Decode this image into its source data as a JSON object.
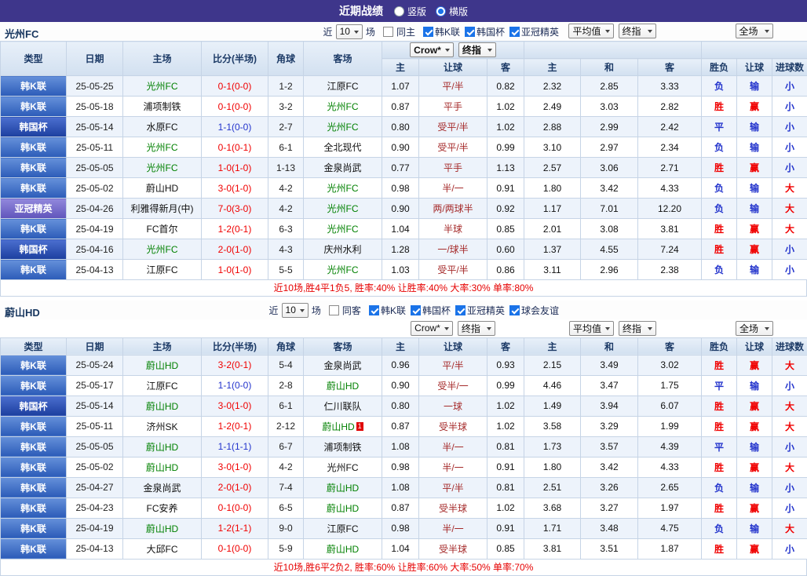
{
  "topbar": {
    "title": "近期战绩",
    "view_options": [
      {
        "label": "竖版",
        "selected": false
      },
      {
        "label": "横版",
        "selected": true
      }
    ]
  },
  "colors": {
    "topbar_purple": "#3e368b",
    "win_red": "#f00000",
    "lose_blue": "#2233cc",
    "self_team_green": "#008000",
    "handicap_text": "#a52a2a",
    "header_blue": "#d2e0f0"
  },
  "dropdowns": {
    "bookmaker": "Crow*",
    "final1": "终指",
    "average": "平均值",
    "final2": "终指",
    "scope": "全场"
  },
  "table_headers": {
    "type": "类型",
    "date": "日期",
    "home": "主场",
    "score": "比分(半场)",
    "corner": "角球",
    "away": "客场",
    "odds_home": "主",
    "odds_line": "让球",
    "odds_away": "客",
    "avg_home": "主",
    "avg_draw": "和",
    "avg_away": "客",
    "result": "胜负",
    "handicap_result": "让球",
    "goals_result": "进球数"
  },
  "sections": [
    {
      "team": "光州FC",
      "filters": {
        "prefix": "近",
        "count": "10",
        "suffix": "场",
        "venue": {
          "label": "同主",
          "checked": false
        },
        "competitions": [
          {
            "label": "韩K联",
            "checked": true
          },
          {
            "label": "韩国杯",
            "checked": true
          },
          {
            "label": "亚冠精英",
            "checked": true
          }
        ]
      },
      "rows": [
        {
          "type": "韩K联",
          "ts": "k",
          "date": "25-05-25",
          "home": "光州FC",
          "home_self": true,
          "score": "0-1(0-0)",
          "score_c": "red",
          "corner": "1-2",
          "away": "江原FC",
          "away_self": false,
          "o1": "1.07",
          "line": "平/半",
          "o2": "0.82",
          "a1": "2.32",
          "a2": "2.85",
          "a3": "3.33",
          "r1": "负",
          "r1c": "blue",
          "r2": "输",
          "r2c": "blue",
          "r3": "小",
          "r3c": "blue"
        },
        {
          "type": "韩K联",
          "ts": "k",
          "date": "25-05-18",
          "home": "浦项制铁",
          "home_self": false,
          "score": "0-1(0-0)",
          "score_c": "red",
          "corner": "3-2",
          "away": "光州FC",
          "away_self": true,
          "o1": "0.87",
          "line": "平手",
          "o2": "1.02",
          "a1": "2.49",
          "a2": "3.03",
          "a3": "2.82",
          "r1": "胜",
          "r1c": "red",
          "r2": "赢",
          "r2c": "red",
          "r3": "小",
          "r3c": "blue"
        },
        {
          "type": "韩国杯",
          "ts": "cup",
          "date": "25-05-14",
          "home": "水原FC",
          "home_self": false,
          "score": "1-1(0-0)",
          "score_c": "blue",
          "corner": "2-7",
          "away": "光州FC",
          "away_self": true,
          "o1": "0.80",
          "line": "受平/半",
          "o2": "1.02",
          "a1": "2.88",
          "a2": "2.99",
          "a3": "2.42",
          "r1": "平",
          "r1c": "blue",
          "r2": "输",
          "r2c": "blue",
          "r3": "小",
          "r3c": "blue"
        },
        {
          "type": "韩K联",
          "ts": "k",
          "date": "25-05-11",
          "home": "光州FC",
          "home_self": true,
          "score": "0-1(0-1)",
          "score_c": "red",
          "corner": "6-1",
          "away": "全北现代",
          "away_self": false,
          "o1": "0.90",
          "line": "受平/半",
          "o2": "0.99",
          "a1": "3.10",
          "a2": "2.97",
          "a3": "2.34",
          "r1": "负",
          "r1c": "blue",
          "r2": "输",
          "r2c": "blue",
          "r3": "小",
          "r3c": "blue"
        },
        {
          "type": "韩K联",
          "ts": "k",
          "date": "25-05-05",
          "home": "光州FC",
          "home_self": true,
          "score": "1-0(1-0)",
          "score_c": "red",
          "corner": "1-13",
          "away": "金泉尚武",
          "away_self": false,
          "o1": "0.77",
          "line": "平手",
          "o2": "1.13",
          "a1": "2.57",
          "a2": "3.06",
          "a3": "2.71",
          "r1": "胜",
          "r1c": "red",
          "r2": "赢",
          "r2c": "red",
          "r3": "小",
          "r3c": "blue"
        },
        {
          "type": "韩K联",
          "ts": "k",
          "date": "25-05-02",
          "home": "蔚山HD",
          "home_self": false,
          "score": "3-0(1-0)",
          "score_c": "red",
          "corner": "4-2",
          "away": "光州FC",
          "away_self": true,
          "o1": "0.98",
          "line": "半/一",
          "o2": "0.91",
          "a1": "1.80",
          "a2": "3.42",
          "a3": "4.33",
          "r1": "负",
          "r1c": "blue",
          "r2": "输",
          "r2c": "blue",
          "r3": "大",
          "r3c": "red"
        },
        {
          "type": "亚冠精英",
          "ts": "acl",
          "date": "25-04-26",
          "home": "利雅得新月(中)",
          "home_self": false,
          "score": "7-0(3-0)",
          "score_c": "red",
          "corner": "4-2",
          "away": "光州FC",
          "away_self": true,
          "o1": "0.90",
          "line": "两/两球半",
          "o2": "0.92",
          "a1": "1.17",
          "a2": "7.01",
          "a3": "12.20",
          "r1": "负",
          "r1c": "blue",
          "r2": "输",
          "r2c": "blue",
          "r3": "大",
          "r3c": "red"
        },
        {
          "type": "韩K联",
          "ts": "k",
          "date": "25-04-19",
          "home": "FC首尔",
          "home_self": false,
          "score": "1-2(0-1)",
          "score_c": "red",
          "corner": "6-3",
          "away": "光州FC",
          "away_self": true,
          "o1": "1.04",
          "line": "半球",
          "o2": "0.85",
          "a1": "2.01",
          "a2": "3.08",
          "a3": "3.81",
          "r1": "胜",
          "r1c": "red",
          "r2": "赢",
          "r2c": "red",
          "r3": "大",
          "r3c": "red"
        },
        {
          "type": "韩国杯",
          "ts": "cup",
          "date": "25-04-16",
          "home": "光州FC",
          "home_self": true,
          "score": "2-0(1-0)",
          "score_c": "red",
          "corner": "4-3",
          "away": "庆州水利",
          "away_self": false,
          "o1": "1.28",
          "line": "一/球半",
          "o2": "0.60",
          "a1": "1.37",
          "a2": "4.55",
          "a3": "7.24",
          "r1": "胜",
          "r1c": "red",
          "r2": "赢",
          "r2c": "red",
          "r3": "小",
          "r3c": "blue"
        },
        {
          "type": "韩K联",
          "ts": "k",
          "date": "25-04-13",
          "home": "江原FC",
          "home_self": false,
          "score": "1-0(1-0)",
          "score_c": "red",
          "corner": "5-5",
          "away": "光州FC",
          "away_self": true,
          "o1": "1.03",
          "line": "受平/半",
          "o2": "0.86",
          "a1": "3.11",
          "a2": "2.96",
          "a3": "2.38",
          "r1": "负",
          "r1c": "blue",
          "r2": "输",
          "r2c": "blue",
          "r3": "小",
          "r3c": "blue"
        }
      ],
      "summary": "近10场,胜4平1负5, 胜率:40% 让胜率:40% 大率:30% 单率:80%"
    },
    {
      "team": "蔚山HD",
      "filters": {
        "prefix": "近",
        "count": "10",
        "suffix": "场",
        "venue": {
          "label": "同客",
          "checked": false
        },
        "competitions": [
          {
            "label": "韩K联",
            "checked": true
          },
          {
            "label": "韩国杯",
            "checked": true
          },
          {
            "label": "亚冠精英",
            "checked": true
          },
          {
            "label": "球会友谊",
            "checked": true
          }
        ]
      },
      "rows": [
        {
          "type": "韩K联",
          "ts": "k",
          "date": "25-05-24",
          "home": "蔚山HD",
          "home_self": true,
          "score": "3-2(0-1)",
          "score_c": "red",
          "corner": "5-4",
          "away": "金泉尚武",
          "away_self": false,
          "o1": "0.96",
          "line": "平/半",
          "o2": "0.93",
          "a1": "2.15",
          "a2": "3.49",
          "a3": "3.02",
          "r1": "胜",
          "r1c": "red",
          "r2": "赢",
          "r2c": "red",
          "r3": "大",
          "r3c": "red"
        },
        {
          "type": "韩K联",
          "ts": "k",
          "date": "25-05-17",
          "home": "江原FC",
          "home_self": false,
          "score": "1-1(0-0)",
          "score_c": "blue",
          "corner": "2-8",
          "away": "蔚山HD",
          "away_self": true,
          "o1": "0.90",
          "line": "受半/一",
          "o2": "0.99",
          "a1": "4.46",
          "a2": "3.47",
          "a3": "1.75",
          "r1": "平",
          "r1c": "blue",
          "r2": "输",
          "r2c": "blue",
          "r3": "小",
          "r3c": "blue"
        },
        {
          "type": "韩国杯",
          "ts": "cup",
          "date": "25-05-14",
          "home": "蔚山HD",
          "home_self": true,
          "score": "3-0(1-0)",
          "score_c": "red",
          "corner": "6-1",
          "away": "仁川联队",
          "away_self": false,
          "o1": "0.80",
          "line": "一球",
          "o2": "1.02",
          "a1": "1.49",
          "a2": "3.94",
          "a3": "6.07",
          "r1": "胜",
          "r1c": "red",
          "r2": "赢",
          "r2c": "red",
          "r3": "大",
          "r3c": "red"
        },
        {
          "type": "韩K联",
          "ts": "k",
          "date": "25-05-11",
          "home": "济州SK",
          "home_self": false,
          "score": "1-2(0-1)",
          "score_c": "red",
          "corner": "2-12",
          "away": "蔚山HD",
          "away_self": true,
          "away_badge": "1",
          "o1": "0.87",
          "line": "受半球",
          "o2": "1.02",
          "a1": "3.58",
          "a2": "3.29",
          "a3": "1.99",
          "r1": "胜",
          "r1c": "red",
          "r2": "赢",
          "r2c": "red",
          "r3": "大",
          "r3c": "red"
        },
        {
          "type": "韩K联",
          "ts": "k",
          "date": "25-05-05",
          "home": "蔚山HD",
          "home_self": true,
          "score": "1-1(1-1)",
          "score_c": "blue",
          "corner": "6-7",
          "away": "浦项制铁",
          "away_self": false,
          "o1": "1.08",
          "line": "半/一",
          "o2": "0.81",
          "a1": "1.73",
          "a2": "3.57",
          "a3": "4.39",
          "r1": "平",
          "r1c": "blue",
          "r2": "输",
          "r2c": "blue",
          "r3": "小",
          "r3c": "blue"
        },
        {
          "type": "韩K联",
          "ts": "k",
          "date": "25-05-02",
          "home": "蔚山HD",
          "home_self": true,
          "score": "3-0(1-0)",
          "score_c": "red",
          "corner": "4-2",
          "away": "光州FC",
          "away_self": false,
          "o1": "0.98",
          "line": "半/一",
          "o2": "0.91",
          "a1": "1.80",
          "a2": "3.42",
          "a3": "4.33",
          "r1": "胜",
          "r1c": "red",
          "r2": "赢",
          "r2c": "red",
          "r3": "大",
          "r3c": "red"
        },
        {
          "type": "韩K联",
          "ts": "k",
          "date": "25-04-27",
          "home": "金泉尚武",
          "home_self": false,
          "score": "2-0(1-0)",
          "score_c": "red",
          "corner": "7-4",
          "away": "蔚山HD",
          "away_self": true,
          "o1": "1.08",
          "line": "平/半",
          "o2": "0.81",
          "a1": "2.51",
          "a2": "3.26",
          "a3": "2.65",
          "r1": "负",
          "r1c": "blue",
          "r2": "输",
          "r2c": "blue",
          "r3": "小",
          "r3c": "blue"
        },
        {
          "type": "韩K联",
          "ts": "k",
          "date": "25-04-23",
          "home": "FC安养",
          "home_self": false,
          "score": "0-1(0-0)",
          "score_c": "red",
          "corner": "6-5",
          "away": "蔚山HD",
          "away_self": true,
          "o1": "0.87",
          "line": "受半球",
          "o2": "1.02",
          "a1": "3.68",
          "a2": "3.27",
          "a3": "1.97",
          "r1": "胜",
          "r1c": "red",
          "r2": "赢",
          "r2c": "red",
          "r3": "小",
          "r3c": "blue"
        },
        {
          "type": "韩K联",
          "ts": "k",
          "date": "25-04-19",
          "home": "蔚山HD",
          "home_self": true,
          "score": "1-2(1-1)",
          "score_c": "red",
          "corner": "9-0",
          "away": "江原FC",
          "away_self": false,
          "o1": "0.98",
          "line": "半/一",
          "o2": "0.91",
          "a1": "1.71",
          "a2": "3.48",
          "a3": "4.75",
          "r1": "负",
          "r1c": "blue",
          "r2": "输",
          "r2c": "blue",
          "r3": "大",
          "r3c": "red"
        },
        {
          "type": "韩K联",
          "ts": "k",
          "date": "25-04-13",
          "home": "大邱FC",
          "home_self": false,
          "score": "0-1(0-0)",
          "score_c": "red",
          "corner": "5-9",
          "away": "蔚山HD",
          "away_self": true,
          "o1": "1.04",
          "line": "受半球",
          "o2": "0.85",
          "a1": "3.81",
          "a2": "3.51",
          "a3": "1.87",
          "r1": "胜",
          "r1c": "red",
          "r2": "赢",
          "r2c": "red",
          "r3": "小",
          "r3c": "blue"
        }
      ],
      "summary": "近10场,胜6平2负2, 胜率:60% 让胜率:60% 大率:50% 单率:70%"
    }
  ]
}
